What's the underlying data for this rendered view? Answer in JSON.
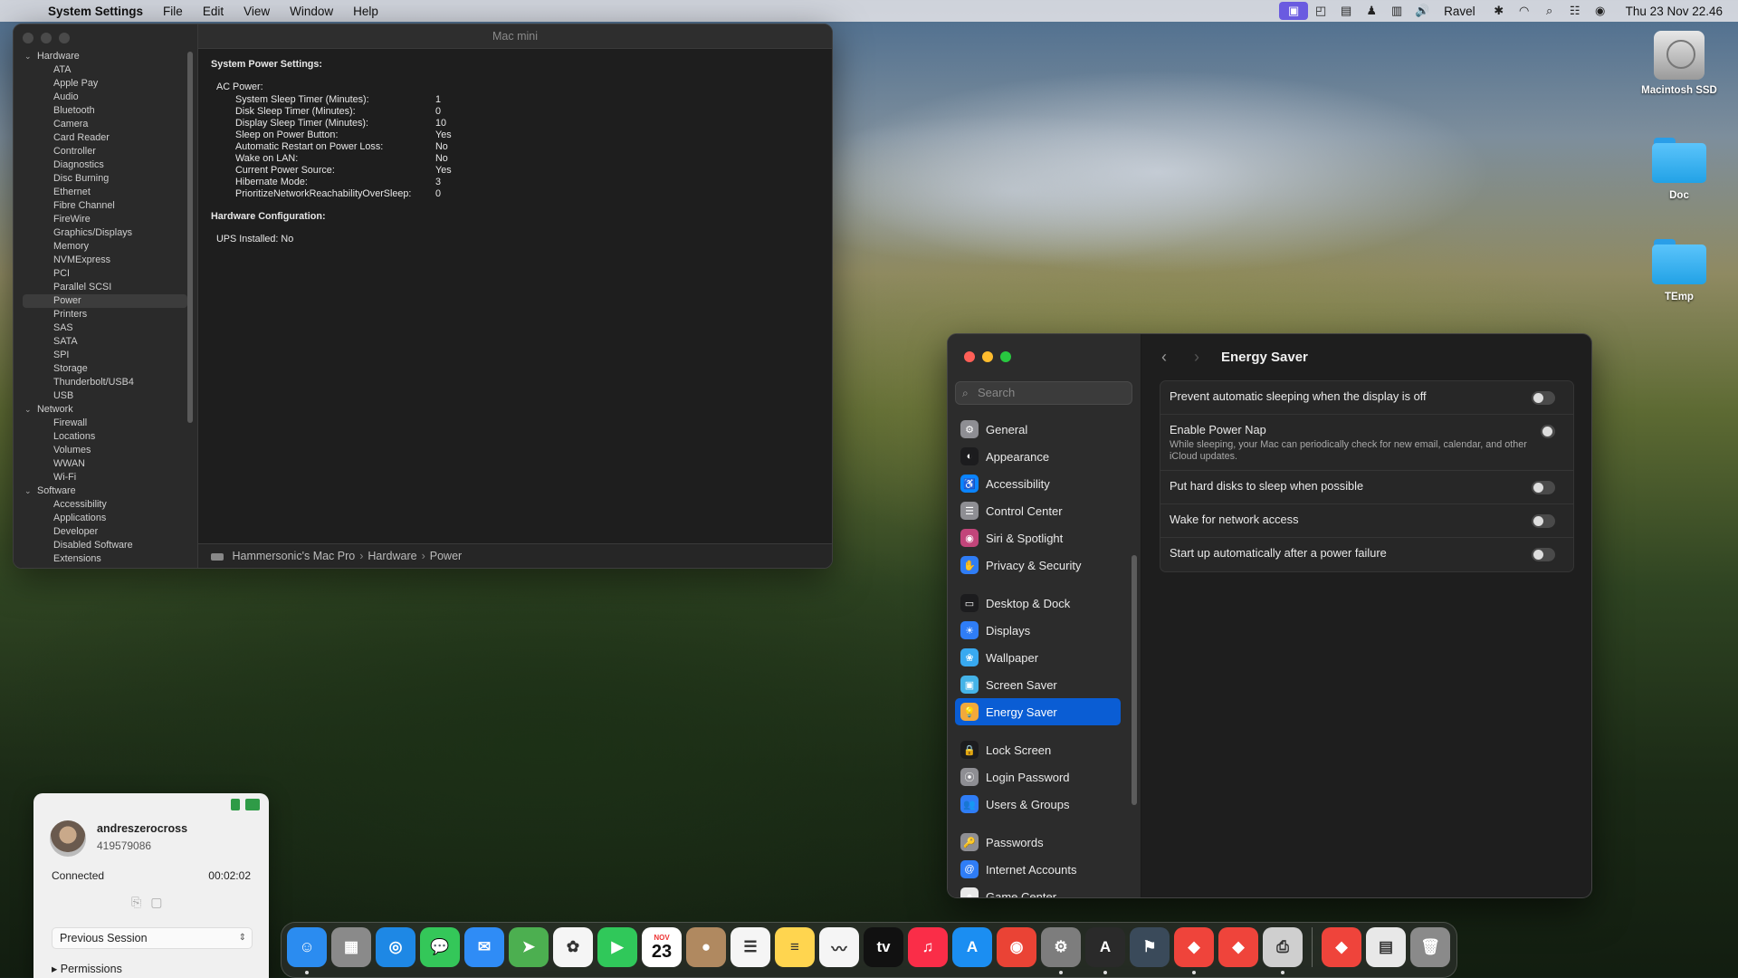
{
  "menubar": {
    "app_name": "System Settings",
    "menus": [
      "File",
      "Edit",
      "View",
      "Window",
      "Help"
    ],
    "user": "Ravel",
    "clock": "Thu 23 Nov  22.46"
  },
  "sysinfo": {
    "window_title": "Mac mini",
    "tree": {
      "hardware_label": "Hardware",
      "hardware_items": [
        "ATA",
        "Apple Pay",
        "Audio",
        "Bluetooth",
        "Camera",
        "Card Reader",
        "Controller",
        "Diagnostics",
        "Disc Burning",
        "Ethernet",
        "Fibre Channel",
        "FireWire",
        "Graphics/Displays",
        "Memory",
        "NVMExpress",
        "PCI",
        "Parallel SCSI",
        "Power",
        "Printers",
        "SAS",
        "SATA",
        "SPI",
        "Storage",
        "Thunderbolt/USB4",
        "USB"
      ],
      "selected": "Power",
      "network_label": "Network",
      "network_items": [
        "Firewall",
        "Locations",
        "Volumes",
        "WWAN",
        "Wi-Fi"
      ],
      "software_label": "Software",
      "software_items": [
        "Accessibility",
        "Applications",
        "Developer",
        "Disabled Software",
        "Extensions"
      ]
    },
    "content": {
      "heading": "System Power Settings:",
      "ac_label": "AC Power:",
      "rows": [
        {
          "k": "System Sleep Timer (Minutes):",
          "v": "1"
        },
        {
          "k": "Disk Sleep Timer (Minutes):",
          "v": "0"
        },
        {
          "k": "Display Sleep Timer (Minutes):",
          "v": "10"
        },
        {
          "k": "Sleep on Power Button:",
          "v": "Yes"
        },
        {
          "k": "Automatic Restart on Power Loss:",
          "v": "No"
        },
        {
          "k": "Wake on LAN:",
          "v": "No"
        },
        {
          "k": "Current Power Source:",
          "v": "Yes"
        },
        {
          "k": "Hibernate Mode:",
          "v": "3"
        },
        {
          "k": "PrioritizeNetworkReachabilityOverSleep:",
          "v": "0"
        }
      ],
      "hw_heading": "Hardware Configuration:",
      "ups": "UPS Installed:  No"
    },
    "path": [
      "Hammersonic's Mac Pro",
      "Hardware",
      "Power"
    ]
  },
  "desktop": {
    "icons": [
      "Macintosh SSD",
      "Doc",
      "TEmp"
    ]
  },
  "settings": {
    "search_placeholder": "Search",
    "title": "Energy Saver",
    "nav": [
      {
        "label": "General",
        "color": "#8e8e93",
        "glyph": "⚙"
      },
      {
        "label": "Appearance",
        "color": "#1c1c1e",
        "glyph": "◐"
      },
      {
        "label": "Accessibility",
        "color": "#0a84ff",
        "glyph": "♿"
      },
      {
        "label": "Control Center",
        "color": "#8e8e93",
        "glyph": "☰"
      },
      {
        "label": "Siri & Spotlight",
        "color": "#c2457a",
        "glyph": "◉"
      },
      {
        "label": "Privacy & Security",
        "color": "#2f7df6",
        "glyph": "✋"
      },
      {
        "label": "Desktop & Dock",
        "color": "#1c1c1e",
        "glyph": "▭"
      },
      {
        "label": "Displays",
        "color": "#2f7df6",
        "glyph": "☀"
      },
      {
        "label": "Wallpaper",
        "color": "#38a9f0",
        "glyph": "❀"
      },
      {
        "label": "Screen Saver",
        "color": "#45b3e8",
        "glyph": "▣"
      },
      {
        "label": "Energy Saver",
        "color": "#f2a93b",
        "glyph": "💡"
      },
      {
        "label": "Lock Screen",
        "color": "#1c1c1e",
        "glyph": "🔒"
      },
      {
        "label": "Login Password",
        "color": "#8e8e93",
        "glyph": "⦿"
      },
      {
        "label": "Users & Groups",
        "color": "#2f7df6",
        "glyph": "👥"
      },
      {
        "label": "Passwords",
        "color": "#8e8e93",
        "glyph": "🔑"
      },
      {
        "label": "Internet Accounts",
        "color": "#2f7df6",
        "glyph": "@"
      },
      {
        "label": "Game Center",
        "color": "#e8e8e8",
        "glyph": "●"
      }
    ],
    "selected": "Energy Saver",
    "options": [
      {
        "label": "Prevent automatic sleeping when the display is off",
        "desc": "",
        "on": false
      },
      {
        "label": "Enable Power Nap",
        "desc": "While sleeping, your Mac can periodically check for new email, calendar, and other iCloud updates.",
        "on": false
      },
      {
        "label": "Put hard disks to sleep when possible",
        "desc": "",
        "on": false
      },
      {
        "label": "Wake for network access",
        "desc": "",
        "on": false
      },
      {
        "label": "Start up automatically after a power failure",
        "desc": "",
        "on": false
      }
    ],
    "help": "?"
  },
  "remote": {
    "username": "andreszerocross",
    "user_id": "419579086",
    "status": "Connected",
    "timer": "00:02:02",
    "session_select": "Previous Session",
    "permissions": "Permissions"
  },
  "dock": {
    "apps": [
      {
        "name": "Finder",
        "color": "#2b8cf0",
        "glyph": "☺",
        "dot": true
      },
      {
        "name": "Launchpad",
        "color": "#8a8a8a",
        "glyph": "▦",
        "dot": false
      },
      {
        "name": "Safari",
        "color": "#1e88e5",
        "glyph": "◎",
        "dot": false
      },
      {
        "name": "Messages",
        "color": "#34c759",
        "glyph": "💬",
        "dot": false
      },
      {
        "name": "Mail",
        "color": "#2f8cf6",
        "glyph": "✉",
        "dot": false
      },
      {
        "name": "Maps",
        "color": "#4caf50",
        "glyph": "➤",
        "dot": false
      },
      {
        "name": "Photos",
        "color": "#f5f5f5",
        "glyph": "✿",
        "dot": false
      },
      {
        "name": "FaceTime",
        "color": "#30c85a",
        "glyph": "▶",
        "dot": false
      },
      {
        "name": "Calendar",
        "color": "#ffffff",
        "glyph": "23",
        "dot": false
      },
      {
        "name": "Contacts",
        "color": "#b08960",
        "glyph": "●",
        "dot": false
      },
      {
        "name": "Reminders",
        "color": "#f5f5f5",
        "glyph": "☰",
        "dot": false
      },
      {
        "name": "Notes",
        "color": "#ffd54f",
        "glyph": "≡",
        "dot": false
      },
      {
        "name": "Freeform",
        "color": "#f5f5f5",
        "glyph": "〰",
        "dot": false
      },
      {
        "name": "TV",
        "color": "#111111",
        "glyph": "tv",
        "dot": false
      },
      {
        "name": "Music",
        "color": "#fa2d48",
        "glyph": "♫",
        "dot": false
      },
      {
        "name": "App Store",
        "color": "#1b8ef2",
        "glyph": "A",
        "dot": false
      },
      {
        "name": "Chrome",
        "color": "#ea4335",
        "glyph": "◉",
        "dot": false
      },
      {
        "name": "System Settings",
        "color": "#7d7d7d",
        "glyph": "⚙",
        "dot": true
      },
      {
        "name": "Apogee",
        "color": "#2a2a2a",
        "glyph": "A",
        "dot": true
      },
      {
        "name": "Flag App",
        "color": "#3a4a5a",
        "glyph": "⚑",
        "dot": false
      },
      {
        "name": "AnyDesk",
        "color": "#ef443b",
        "glyph": "◆",
        "dot": true
      },
      {
        "name": "AnyDesk Alt",
        "color": "#ef443b",
        "glyph": "◆",
        "dot": false
      },
      {
        "name": "Printer",
        "color": "#cfcfcf",
        "glyph": "⎙",
        "dot": true
      },
      {
        "name": "AnyDesk Doc",
        "color": "#ef443b",
        "glyph": "◆",
        "dot": false
      },
      {
        "name": "Document",
        "color": "#e8e8e8",
        "glyph": "▤",
        "dot": false
      },
      {
        "name": "Trash",
        "color": "#8a8a8a",
        "glyph": "🗑",
        "dot": false
      }
    ],
    "separator_after": 22
  }
}
